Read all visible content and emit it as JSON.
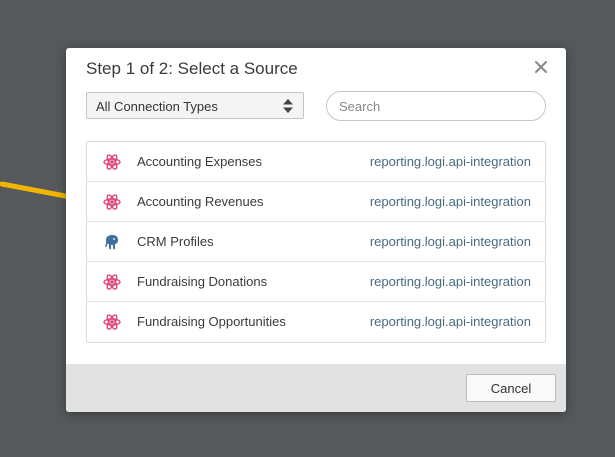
{
  "dialog": {
    "title": "Step 1 of 2: Select a Source"
  },
  "filter": {
    "connection_type": "All Connection Types"
  },
  "search": {
    "placeholder": "Search",
    "value": ""
  },
  "sources": [
    {
      "name": "Accounting Expenses",
      "connection": "reporting.logi.api-integration",
      "icon": "atom-icon"
    },
    {
      "name": "Accounting Revenues",
      "connection": "reporting.logi.api-integration",
      "icon": "atom-icon"
    },
    {
      "name": "CRM Profiles",
      "connection": "reporting.logi.api-integration",
      "icon": "elephant-icon"
    },
    {
      "name": "Fundraising Donations",
      "connection": "reporting.logi.api-integration",
      "icon": "atom-icon"
    },
    {
      "name": "Fundraising Opportunities",
      "connection": "reporting.logi.api-integration",
      "icon": "atom-icon"
    }
  ],
  "footer": {
    "cancel_label": "Cancel"
  },
  "colors": {
    "atom_icon": "#e0457b",
    "elephant_icon": "#3f6f9e",
    "arrow": "#f2b500",
    "link_text": "#4a6a80"
  }
}
